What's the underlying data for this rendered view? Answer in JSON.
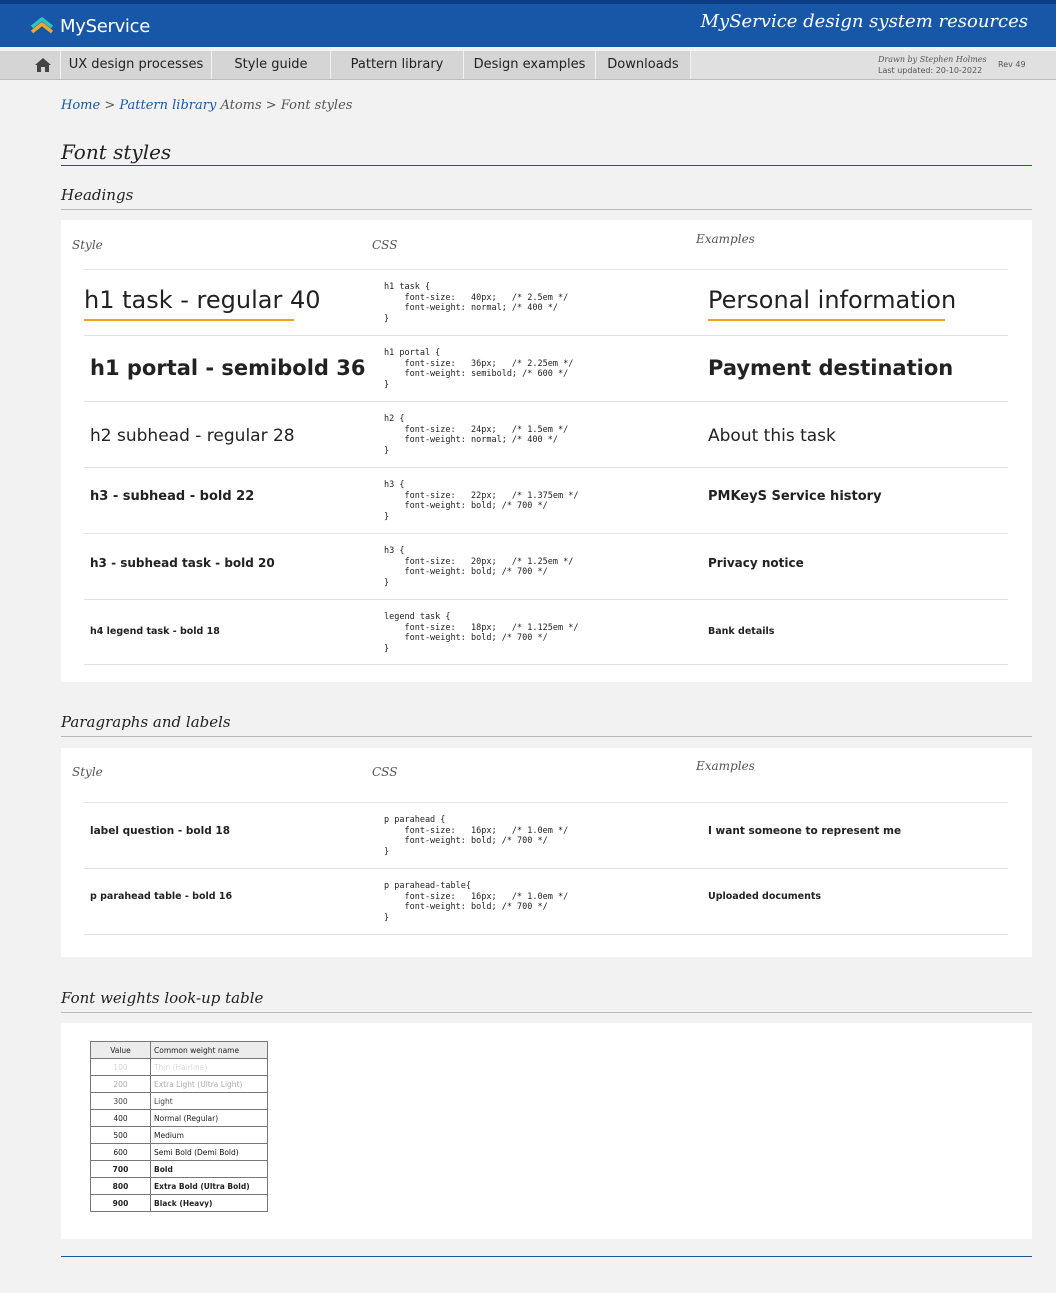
{
  "header": {
    "logo_text": "MyService",
    "title": "MyService design system resources"
  },
  "nav": {
    "items": [
      "UX design processes",
      "Style guide",
      "Pattern library",
      "Design examples",
      "Downloads"
    ],
    "drawn_by": "Drawn by Stephen Holmes",
    "last_updated": "Last updated: 20-10-2022",
    "rev": "Rev 49"
  },
  "breadcrumb": {
    "home": "Home",
    "pattern_library": "Pattern library",
    "rest": "Atoms > Font styles",
    "sep": ">"
  },
  "page_title": "Font styles",
  "col_heads": {
    "style": "Style",
    "css": "CSS",
    "examples": "Examples"
  },
  "headings": {
    "title": "Headings",
    "rows": [
      {
        "style": "h1 task - regular 40",
        "css": "h1 task {\n    font-size:   40px;   /* 2.5em */\n    font-weight: normal; /* 400 */\n}",
        "example": "Personal information"
      },
      {
        "style": "h1 portal - semibold 36",
        "css": "h1 portal {\n    font-size:   36px;   /* 2.25em */\n    font-weight: semibold; /* 600 */\n}",
        "example": "Payment destination"
      },
      {
        "style": "h2 subhead - regular 28",
        "css": "h2 {\n    font-size:   24px;   /* 1.5em */\n    font-weight: normal; /* 400 */\n}",
        "example": "About this task"
      },
      {
        "style": "h3 - subhead - bold 22",
        "css": "h3 {\n    font-size:   22px;   /* 1.375em */\n    font-weight: bold; /* 700 */\n}",
        "example": "PMKeyS Service history"
      },
      {
        "style": "h3 - subhead task - bold 20",
        "css": "h3 {\n    font-size:   20px;   /* 1.25em */\n    font-weight: bold; /* 700 */\n}",
        "example": "Privacy notice"
      },
      {
        "style": "h4 legend task - bold 18",
        "css": "legend task {\n    font-size:   18px;   /* 1.125em */\n    font-weight: bold; /* 700 */\n}",
        "example": "Bank details"
      }
    ]
  },
  "paragraphs": {
    "title": "Paragraphs and labels",
    "rows": [
      {
        "style": "label question - bold 18",
        "css": "p parahead {\n    font-size:   16px;   /* 1.0em */\n    font-weight: bold; /* 700 */\n}",
        "example": "I want someone to represent me"
      },
      {
        "style": "p parahead table - bold 16",
        "css": "p parahead-table{\n    font-size:   16px;   /* 1.0em */\n    font-weight: bold; /* 700 */\n}",
        "example": "Uploaded documents"
      }
    ]
  },
  "weights": {
    "title": "Font weights look-up table",
    "headers": [
      "Value",
      "Common weight name"
    ],
    "rows": [
      {
        "value": "100",
        "name": "Thin (Hairline)"
      },
      {
        "value": "200",
        "name": "Extra Light (Ultra Light)"
      },
      {
        "value": "300",
        "name": "Light"
      },
      {
        "value": "400",
        "name": "Normal (Regular)"
      },
      {
        "value": "500",
        "name": "Medium"
      },
      {
        "value": "600",
        "name": "Semi Bold (Demi Bold)"
      },
      {
        "value": "700",
        "name": "Bold"
      },
      {
        "value": "800",
        "name": "Extra Bold (Ultra Bold)"
      },
      {
        "value": "900",
        "name": "Black (Heavy)"
      }
    ]
  }
}
